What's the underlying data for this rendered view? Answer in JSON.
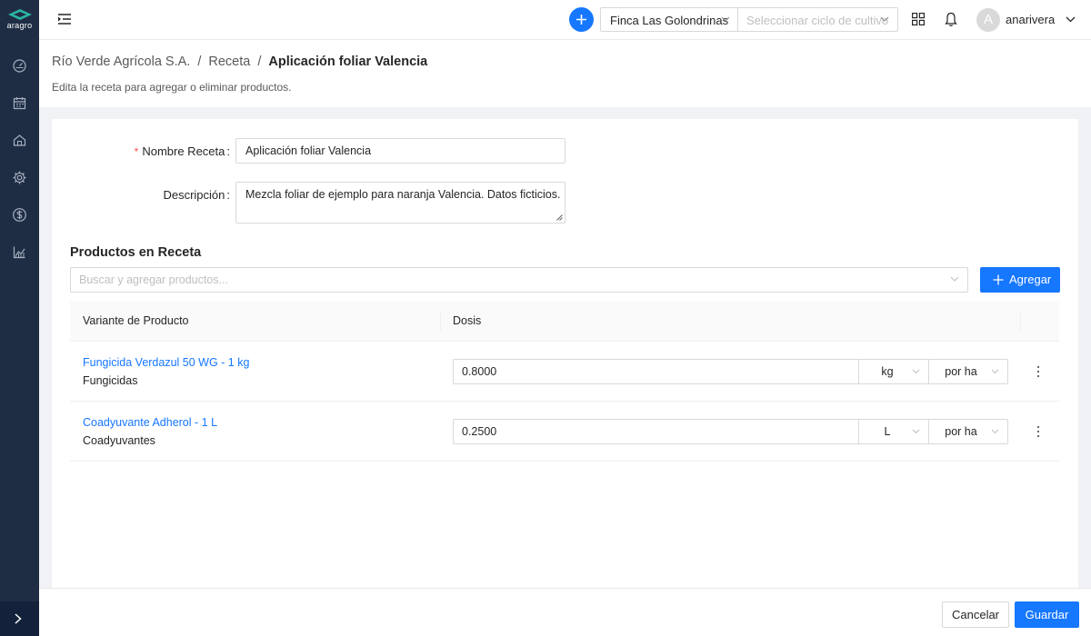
{
  "app": {
    "logo_text": "aragro"
  },
  "sidebar": {
    "items": [
      {
        "icon": "dashboard-icon"
      },
      {
        "icon": "calendar-icon"
      },
      {
        "icon": "home-icon"
      },
      {
        "icon": "settings-icon"
      },
      {
        "icon": "dollar-icon"
      },
      {
        "icon": "chart-icon"
      }
    ],
    "expand_icon": "chevron-right-icon"
  },
  "header": {
    "farm": "Finca Las Golondrinas",
    "cycle_placeholder": "Seleccionar ciclo de cultivo",
    "user_initial": "A",
    "user_name": "anarivera"
  },
  "breadcrumb": {
    "items": [
      "Río Verde Agrícola S.A.",
      "Receta"
    ],
    "current": "Aplicación foliar Valencia",
    "separator": "/"
  },
  "page": {
    "subtitle": "Edita la receta para agregar o eliminar productos."
  },
  "form": {
    "required_mark": "*",
    "name_label": "Nombre Receta",
    "name_value": "Aplicación foliar Valencia",
    "description_label": "Descripción",
    "description_value": "Mezcla foliar de ejemplo para naranja Valencia. Datos ficticios.",
    "colon": ":"
  },
  "products": {
    "title": "Productos en Receta",
    "search_placeholder": "Buscar y agregar productos...",
    "add_label": "Agregar",
    "columns": [
      "Variante de Producto",
      "Dosis"
    ],
    "rows": [
      {
        "name": "Fungicida Verdazul 50 WG - 1 kg",
        "category": "Fungicidas",
        "dose": "0.8000",
        "unit": "kg",
        "per": "por ha"
      },
      {
        "name": "Coadyuvante Adherol - 1 L",
        "category": "Coadyuvantes",
        "dose": "0.2500",
        "unit": "L",
        "per": "por ha"
      }
    ]
  },
  "footer": {
    "cancel_label": "Cancelar",
    "save_label": "Guardar"
  },
  "colors": {
    "primary": "#1677ff",
    "sidebar": "#1f2d44",
    "logo_accent": "#2bb5a0"
  }
}
